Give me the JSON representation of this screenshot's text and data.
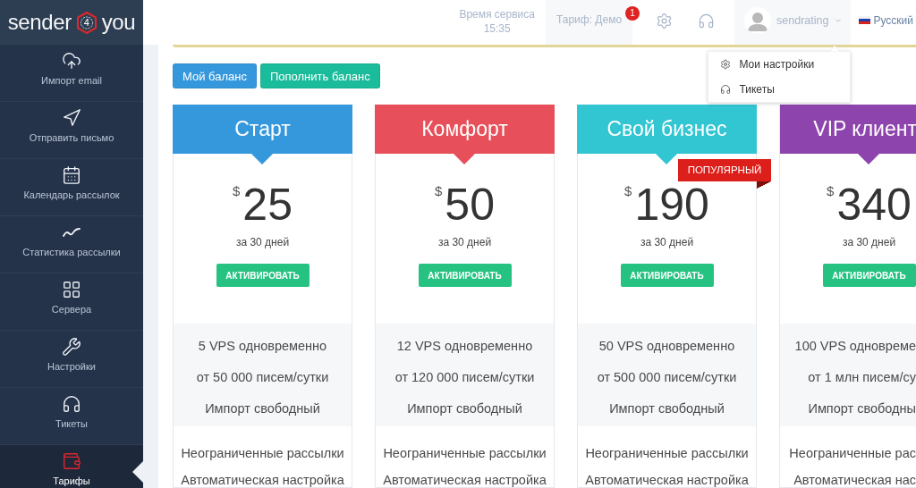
{
  "logo": {
    "text_before": "sender",
    "mark": "4",
    "text_after": "you"
  },
  "sidebar": {
    "items": [
      {
        "label": "Импорт email",
        "selected": false
      },
      {
        "label": "Отправить письмо",
        "selected": false
      },
      {
        "label": "Календарь рассылок",
        "selected": false
      },
      {
        "label": "Статистика рассылки",
        "selected": false
      },
      {
        "label": "Сервера",
        "selected": false
      },
      {
        "label": "Настройки",
        "selected": false
      },
      {
        "label": "Тикеты",
        "selected": false
      },
      {
        "label": "Тарифы",
        "selected": true
      }
    ]
  },
  "header": {
    "service_time": {
      "label": "Время сервиса",
      "value": "15:35"
    },
    "tariff": {
      "label": "Тариф: Демо",
      "badge": "1"
    },
    "user": {
      "name": "sendrating",
      "expanded": true
    },
    "language": "Русский"
  },
  "user_menu": {
    "items": [
      {
        "label": "Мои настройки"
      },
      {
        "label": "Тикеты"
      }
    ]
  },
  "balance_buttons": [
    {
      "label": "Мой баланс",
      "color": "#3598dc"
    },
    {
      "label": "Пополнить баланс",
      "color": "#1bbc9b"
    }
  ],
  "plans": [
    {
      "title": "Старт",
      "color": "#3598dc",
      "currency": "$",
      "price": "25",
      "period": "за 30 дней",
      "button": "АКТИВИРОВАТЬ",
      "limits": [
        "5 VPS одновременно",
        "от 50 000 писем/сутки",
        "Импорт свободный"
      ],
      "features": [
        "Неограниченные рассылки",
        "Автоматическая настройка"
      ]
    },
    {
      "title": "Комфорт",
      "color": "#e7505a",
      "currency": "$",
      "price": "50",
      "period": "за 30 дней",
      "button": "АКТИВИРОВАТЬ",
      "limits": [
        "12 VPS одновременно",
        "от 120 000 писем/сутки",
        "Импорт свободный"
      ],
      "features": [
        "Неограниченные рассылки",
        "Автоматическая настройка"
      ]
    },
    {
      "title": "Свой бизнес",
      "color": "#32c5d2",
      "currency": "$",
      "price": "190",
      "period": "за 30 дней",
      "button": "АКТИВИРОВАТЬ",
      "badge": "ПОПУЛЯРНЫЙ",
      "limits": [
        "50 VPS одновременно",
        "от 500 000 писем/сутки",
        "Импорт свободный"
      ],
      "features": [
        "Неограниченные рассылки",
        "Автоматическая настройка"
      ]
    },
    {
      "title": "VIP клиент",
      "color": "#8e44ad",
      "currency": "$",
      "price": "340",
      "period": "за 30 дней",
      "button": "АКТИВИРОВАТЬ",
      "limits": [
        "100 VPS одновреме",
        "от 1 млн писем/су",
        "Импорт свободны"
      ],
      "features": [
        "Неограниченные рас",
        "Автоматическая нас"
      ]
    }
  ]
}
